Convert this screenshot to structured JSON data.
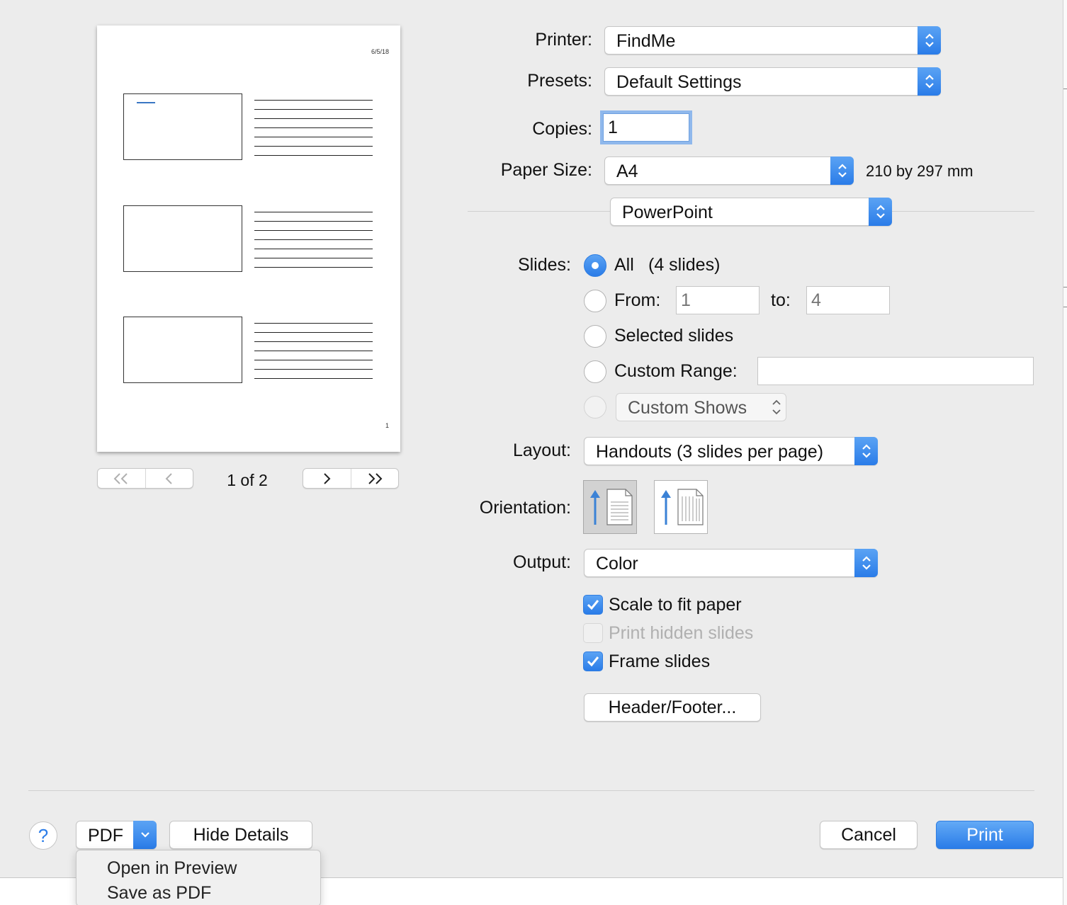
{
  "printer": {
    "label": "Printer:",
    "value": "FindMe"
  },
  "presets": {
    "label": "Presets:",
    "value": "Default Settings"
  },
  "copies": {
    "label": "Copies:",
    "value": "1"
  },
  "paper_size": {
    "label": "Paper Size:",
    "value": "A4",
    "dimensions": "210 by 297 mm"
  },
  "app_section": {
    "value": "PowerPoint"
  },
  "slides": {
    "label": "Slides:",
    "all_label": "All",
    "all_count": "(4 slides)",
    "from_label": "From:",
    "from_placeholder": "1",
    "to_label": "to:",
    "to_placeholder": "4",
    "selected_label": "Selected slides",
    "custom_range_label": "Custom Range:",
    "custom_range_value": "",
    "custom_shows_value": "Custom Shows",
    "selected_option": "all"
  },
  "layout": {
    "label": "Layout:",
    "value": "Handouts (3 slides per page)"
  },
  "orientation": {
    "label": "Orientation:",
    "selected": "portrait"
  },
  "output": {
    "label": "Output:",
    "value": "Color"
  },
  "options": {
    "scale_to_fit": {
      "label": "Scale to fit paper",
      "checked": true
    },
    "print_hidden": {
      "label": "Print hidden slides",
      "checked": false,
      "enabled": false
    },
    "frame_slides": {
      "label": "Frame slides",
      "checked": true
    }
  },
  "header_footer_label": "Header/Footer...",
  "preview": {
    "date": "6/5/18",
    "page_number": "1",
    "pager_text": "1 of 2",
    "slides_per_page": 3,
    "lines_per_slide": 7
  },
  "footer": {
    "help_label": "?",
    "pdf_label": "PDF",
    "hide_details_label": "Hide Details",
    "cancel_label": "Cancel",
    "print_label": "Print"
  },
  "pdf_menu": {
    "items": [
      "Open in Preview",
      "Save as PDF"
    ]
  },
  "colors": {
    "accent": "#2a7ce8",
    "background": "#ececec"
  }
}
